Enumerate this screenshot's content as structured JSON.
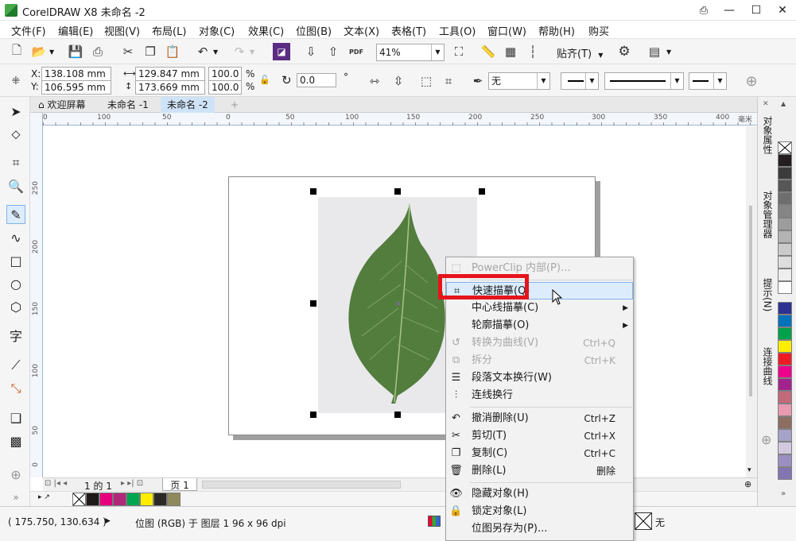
{
  "window": {
    "title": "CorelDRAW X8  未命名 -2",
    "controls": [
      "minimize-icon",
      "maximize-icon",
      "close-icon"
    ]
  },
  "menu": [
    "文件(F)",
    "编辑(E)",
    "视图(V)",
    "布局(L)",
    "对象(C)",
    "效果(C)",
    "位图(B)",
    "文本(X)",
    "表格(T)",
    "工具(O)",
    "窗口(W)",
    "帮助(H)",
    "购买"
  ],
  "toolbar": {
    "zoom": "41%",
    "snap_label": "贴齐(T)"
  },
  "properties": {
    "x": "138.108 mm",
    "y": "106.595 mm",
    "width": "129.847 mm",
    "height": "173.669 mm",
    "scale_x": "100.0",
    "scale_y": "100.0",
    "percent": "%",
    "rotation": "0.0",
    "degree": "°",
    "outline_none": "无"
  },
  "tabs": {
    "welcome": "欢迎屏幕",
    "doc1": "未命名 -1",
    "doc2": "未命名 -2"
  },
  "ruler": {
    "h_labels": [
      "0",
      "100",
      "50",
      "0",
      "50",
      "100",
      "150",
      "200",
      "250",
      "300",
      "350",
      "400"
    ],
    "h_unit": "毫米",
    "v_labels": [
      "250",
      "200",
      "150",
      "100",
      "50",
      "0"
    ]
  },
  "page_nav": {
    "page_of": "1 的 1",
    "page_tab": "页 1"
  },
  "docker_tabs": [
    "对象属性",
    "对象管理器",
    "提示(N)",
    "连接曲线"
  ],
  "status": {
    "coords": "( 175.750, 130.634 )",
    "info": "位图 (RGB) 于 图层 1 96 x 96 dpi",
    "fill_none": "无"
  },
  "context_menu": [
    {
      "label": "PowerClip 内部(P)...",
      "disabled": true,
      "icon": "powerclip-icon"
    },
    {
      "label": "快速描摹(Q)",
      "highlight": true,
      "icon": "quick-trace-icon"
    },
    {
      "label": "中心线描摹(C)",
      "submenu": true
    },
    {
      "label": "轮廓描摹(O)",
      "submenu": true
    },
    {
      "label": "转换为曲线(V)",
      "shortcut": "Ctrl+Q",
      "disabled": true,
      "icon": "convert-curves-icon"
    },
    {
      "label": "拆分",
      "shortcut": "Ctrl+K",
      "disabled": true,
      "icon": "break-apart-icon"
    },
    {
      "label": "段落文本换行(W)",
      "icon": "wrap-text-icon"
    },
    {
      "label": "连线换行",
      "icon": "wrap-line-icon"
    },
    {
      "label": "撤消删除(U)",
      "shortcut": "Ctrl+Z",
      "icon": "undo-icon"
    },
    {
      "label": "剪切(T)",
      "shortcut": "Ctrl+X",
      "icon": "cut-icon"
    },
    {
      "label": "复制(C)",
      "shortcut": "Ctrl+C",
      "icon": "copy-icon"
    },
    {
      "label": "删除(L)",
      "shortcut": "删除",
      "icon": "trash-icon"
    },
    {
      "label": "隐藏对象(H)",
      "icon": "hide-icon"
    },
    {
      "label": "锁定对象(L)",
      "icon": "lock-icon"
    },
    {
      "label": "位图另存为(P)...",
      "icon": "save-bitmap-icon"
    }
  ],
  "colors": {
    "accent_red": "#e5141c",
    "menu_highlight": "#dcecfc",
    "leaf_green": "#4f7a3a"
  }
}
